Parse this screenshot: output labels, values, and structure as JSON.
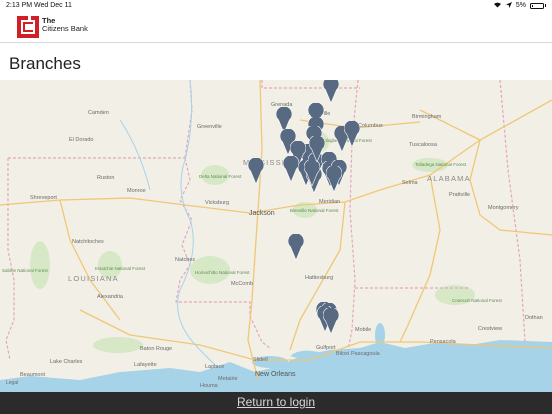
{
  "status_bar": {
    "time": "2:13 PM",
    "date": "Wed Dec 11",
    "battery_percent": "5%",
    "battery_level": 0.05,
    "icons": [
      "wifi-icon",
      "location-arrow-icon",
      "battery-icon"
    ]
  },
  "header": {
    "brand_line1": "The",
    "brand_line2": "Citizens Bank",
    "logo_color": "#d11f26"
  },
  "page": {
    "title": "Branches"
  },
  "map": {
    "states": [
      "MISSISSIPPI",
      "LOUISIANA",
      "ALABAMA"
    ],
    "cities": [
      "Grenada",
      "Starkville",
      "Columbus",
      "Greenville",
      "Camden",
      "El Dorado",
      "Birmingham",
      "Tuscaloosa",
      "Meridian",
      "Jackson",
      "Vicksburg",
      "Shreveport",
      "Monroe",
      "Ruston",
      "Natchitoches",
      "Natchez",
      "McComb",
      "Hattiesburg",
      "Alexandria",
      "Lafayette",
      "Baton Rouge",
      "New Orleans",
      "Gulfport",
      "Mobile",
      "Pensacola",
      "Beaumont",
      "Prattville",
      "Montgomery",
      "Selma",
      "Dothan",
      "Houma",
      "Slidell",
      "Biloxi",
      "Pascagoula",
      "Metairie",
      "Lake Charles",
      "Crestview",
      "Laplace"
    ],
    "forests": [
      "Delta National Forest",
      "Homochitto National Forest",
      "Bienville National Forest",
      "Tombigbee National Forest",
      "Talladega National Forest",
      "Conecuh National Forest",
      "Sabine National Forest",
      "Kisatchie National Forest"
    ],
    "legal_label": "Legal",
    "pin_count": 26,
    "pin_color": "#586a82"
  },
  "footer": {
    "return_label": "Return to login"
  }
}
